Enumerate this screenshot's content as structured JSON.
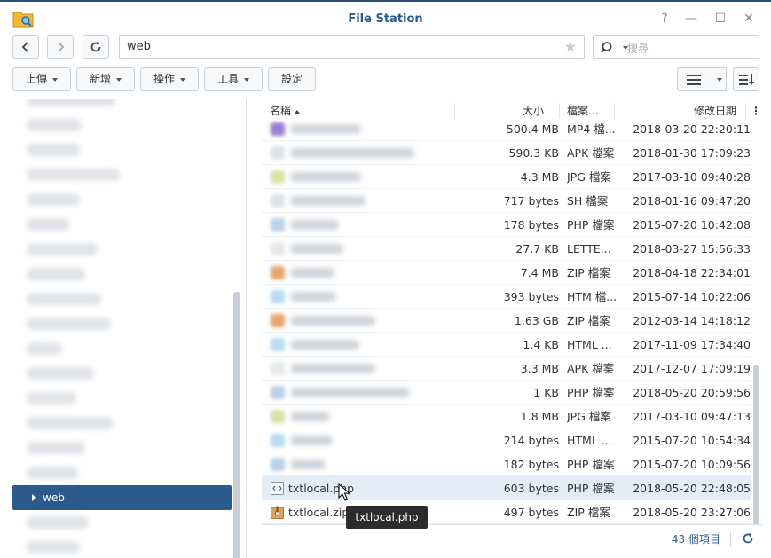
{
  "window": {
    "title": "File Station",
    "controls": [
      "?",
      "—",
      "☐",
      "✕"
    ]
  },
  "nav": {
    "path": "web",
    "search_placeholder": "搜尋"
  },
  "toolbar": {
    "upload": "上傳",
    "create": "新增",
    "action": "操作",
    "tools": "工具",
    "settings": "設定"
  },
  "sidebar": {
    "selected": "web"
  },
  "list": {
    "columns": {
      "name": "名稱",
      "size": "大小",
      "type": "檔案...",
      "date": "修改日期"
    },
    "rows": [
      {
        "size": "500.4 MB",
        "type": "MP4 檔...",
        "date": "2018-03-20 22:20:11"
      },
      {
        "size": "590.3 KB",
        "type": "APK 檔案",
        "date": "2018-01-30 17:09:23"
      },
      {
        "size": "4.3 MB",
        "type": "JPG 檔案",
        "date": "2017-03-10 09:40:28"
      },
      {
        "size": "717 bytes",
        "type": "SH 檔案",
        "date": "2018-01-16 09:47:20"
      },
      {
        "size": "178 bytes",
        "type": "PHP 檔案",
        "date": "2015-07-20 10:42:08"
      },
      {
        "size": "27.7 KB",
        "type": "LETTE...",
        "date": "2018-03-27 15:56:33"
      },
      {
        "size": "7.4 MB",
        "type": "ZIP 檔案",
        "date": "2018-04-18 22:34:01"
      },
      {
        "size": "393 bytes",
        "type": "HTM 檔...",
        "date": "2015-07-14 10:22:06"
      },
      {
        "size": "1.63 GB",
        "type": "ZIP 檔案",
        "date": "2012-03-14 14:18:12"
      },
      {
        "size": "1.4 KB",
        "type": "HTML ...",
        "date": "2017-11-09 17:34:40"
      },
      {
        "size": "3.3 MB",
        "type": "APK 檔案",
        "date": "2017-12-07 17:09:19"
      },
      {
        "size": "1 KB",
        "type": "PHP 檔案",
        "date": "2018-05-20 20:59:56"
      },
      {
        "size": "1.8 MB",
        "type": "JPG 檔案",
        "date": "2017-03-10 09:47:13"
      },
      {
        "size": "214 bytes",
        "type": "HTML ...",
        "date": "2015-07-20 10:54:34"
      },
      {
        "size": "182 bytes",
        "type": "PHP 檔案",
        "date": "2015-07-20 10:09:56"
      },
      {
        "name": "txtlocal.php",
        "size": "603 bytes",
        "type": "PHP 檔案",
        "date": "2018-05-20 22:48:05"
      },
      {
        "name": "txtlocal.zip",
        "size": "497 bytes",
        "type": "ZIP 檔案",
        "date": "2018-05-20 23:27:06"
      }
    ],
    "item_count": "43 個項目",
    "tooltip": "txtlocal.php"
  },
  "colors": {
    "accent": "#2b5a8c",
    "selection": "#e3edf8"
  }
}
